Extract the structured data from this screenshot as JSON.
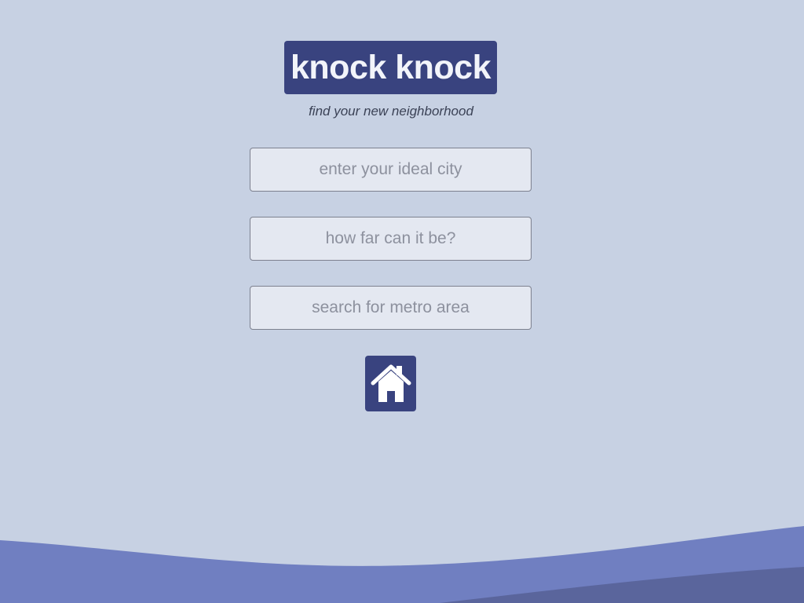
{
  "brand": {
    "logo_text": "knock knock",
    "tagline": "find your new neighborhood",
    "primary_color": "#39437f",
    "background_color": "#c7d1e3",
    "wave_color_light": "#707fc1",
    "wave_color_dark": "#5a659c"
  },
  "form": {
    "city": {
      "value": "",
      "placeholder": "enter your ideal city"
    },
    "distance": {
      "value": "",
      "placeholder": "how far can it be?"
    },
    "metro": {
      "value": "",
      "placeholder": "search for metro area"
    }
  },
  "submit": {
    "icon": "home-icon"
  }
}
